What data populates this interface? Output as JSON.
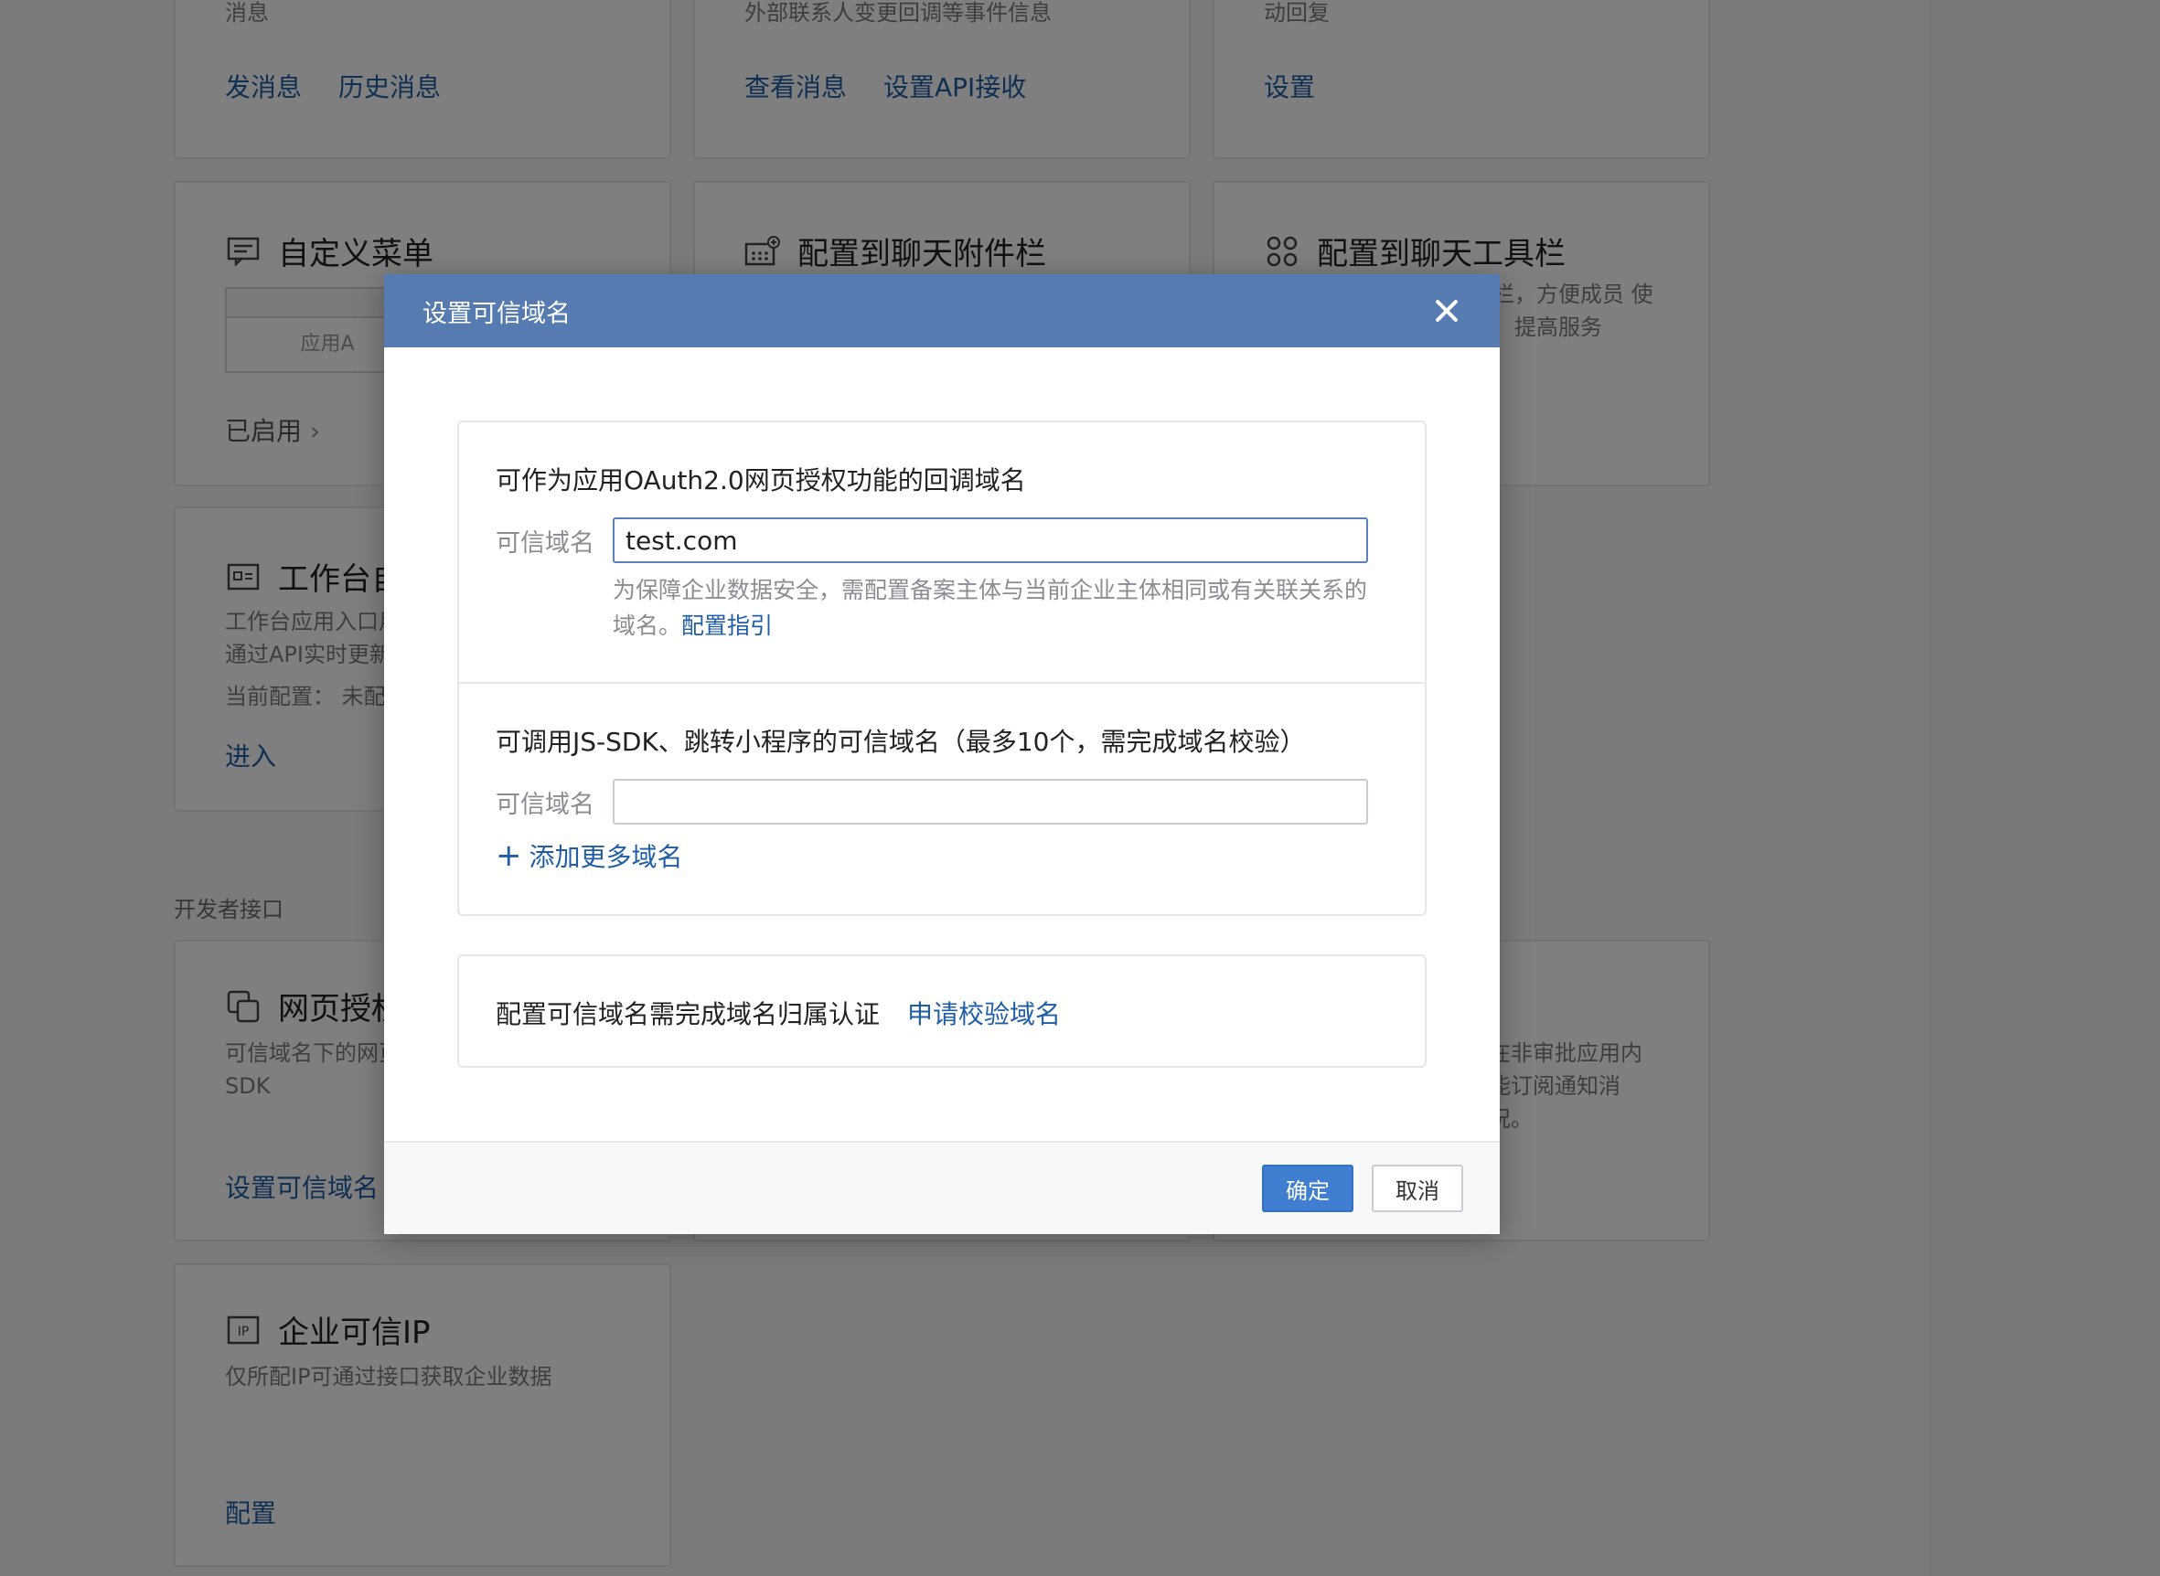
{
  "background": {
    "cards": [
      {
        "id": "msg",
        "desc": "消息",
        "links": [
          "发消息",
          "历史消息"
        ]
      },
      {
        "id": "contact",
        "desc": "外部联系人变更回调等事件信息",
        "links": [
          "查看消息",
          "设置API接收"
        ]
      },
      {
        "id": "auto",
        "desc": "动回复",
        "links": [
          "设置"
        ]
      },
      {
        "id": "menu",
        "title": "自定义菜单",
        "preview": "应用A",
        "status": "已启用"
      },
      {
        "id": "attach",
        "title": "配置到聊天附件栏"
      },
      {
        "id": "toolbar",
        "title": "配置到聊天工具栏",
        "desc": "具栏，方便成员 使用，提高服务"
      },
      {
        "id": "workbench",
        "title": "工作台自",
        "desc_lines": [
          "工作台应用入口用",
          "通过API实时更新"
        ],
        "config": "当前配置： 未配",
        "link": "进入"
      },
      {
        "id": "webauth",
        "title": "网页授权",
        "desc_lines": [
          "可信域名下的网页",
          "SDK"
        ],
        "link": "设置可信域名"
      },
      {
        "id": "approval",
        "desc_lines": [
          "在非审批应用内",
          "能订阅通知消",
          "况。"
        ]
      },
      {
        "id": "trustip",
        "title": "企业可信IP",
        "desc": "仅所配IP可通过接口获取企业数据",
        "link": "配置"
      }
    ],
    "section_label": "开发者接口"
  },
  "modal": {
    "title": "设置可信域名",
    "oauth": {
      "heading": "可作为应用OAuth2.0网页授权功能的回调域名",
      "label": "可信域名",
      "value": "test.com",
      "hint": "为保障企业数据安全，需配置备案主体与当前企业主体相同或有关联关系的域名。",
      "hint_link": "配置指引"
    },
    "jssdk": {
      "heading": "可调用JS-SDK、跳转小程序的可信域名（最多10个，需完成域名校验）",
      "label": "可信域名",
      "value": "",
      "add_more": "添加更多域名"
    },
    "verify": {
      "text": "配置可信域名需完成域名归属认证",
      "link": "申请校验域名"
    },
    "ok_label": "确定",
    "cancel_label": "取消"
  },
  "colors": {
    "header": "#557bb0",
    "link": "#1f5ea6",
    "primary_button": "#3f7ed1"
  }
}
